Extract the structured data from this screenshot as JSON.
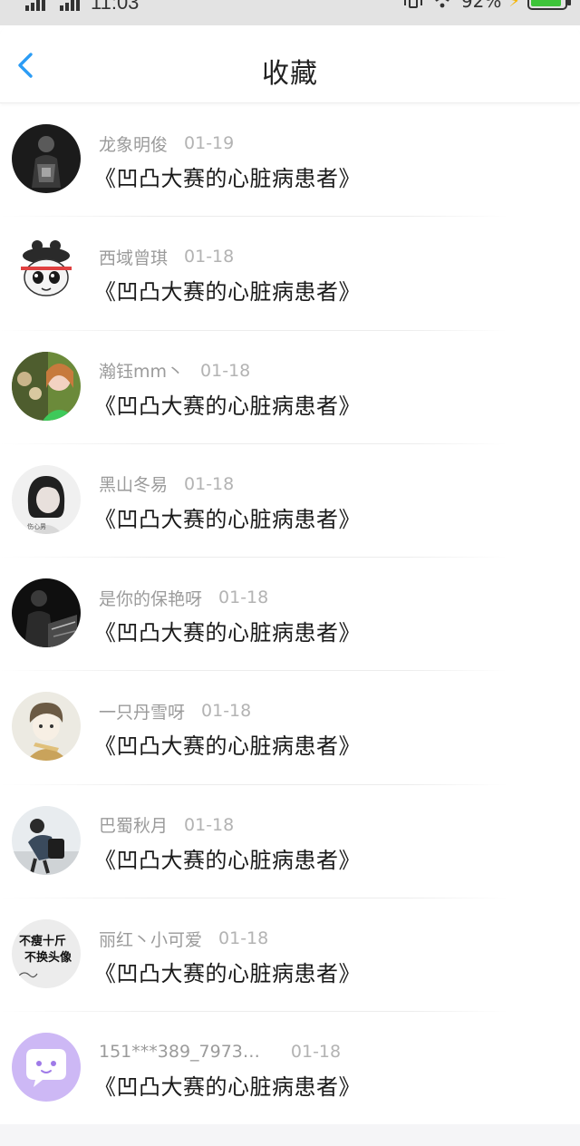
{
  "status_bar": {
    "time": "11:03",
    "battery": "92%",
    "battery_level": 0.92,
    "icons": [
      "signal-icon",
      "signal-icon",
      "vibrate-icon",
      "wifi-icon",
      "bolt-icon",
      "battery-icon"
    ]
  },
  "header": {
    "back_icon": "chevron-left-icon",
    "title": "收藏"
  },
  "colors": {
    "accent": "#2b9cf5",
    "text_primary": "#1a1a1a",
    "text_secondary": "#9b9b9b",
    "battery": "#3ec43a",
    "bolt": "#f5b300"
  },
  "items": [
    {
      "name": "龙象明俊",
      "date": "01-19",
      "title": "《凹凸大赛的心脏病患者》"
    },
    {
      "name": "西域曾琪",
      "date": "01-18",
      "title": "《凹凸大赛的心脏病患者》"
    },
    {
      "name": "瀚钰mm丶",
      "date": "01-18",
      "title": "《凹凸大赛的心脏病患者》"
    },
    {
      "name": "黑山冬易",
      "date": "01-18",
      "title": "《凹凸大赛的心脏病患者》"
    },
    {
      "name": "是你的保艳呀",
      "date": "01-18",
      "title": "《凹凸大赛的心脏病患者》"
    },
    {
      "name": "一只丹雪呀",
      "date": "01-18",
      "title": "《凹凸大赛的心脏病患者》"
    },
    {
      "name": "巴蜀秋月",
      "date": "01-18",
      "title": "《凹凸大赛的心脏病患者》"
    },
    {
      "name": "丽红丶小可爱",
      "date": "01-18",
      "title": "《凹凸大赛的心脏病患者》"
    },
    {
      "name": "151***389_7973…",
      "date": "01-18",
      "title": "《凹凸大赛的心脏病患者》"
    }
  ],
  "avatar_text": {
    "item8_line1": "不瘦十斤",
    "item8_line2": "不换头像",
    "item4_caption": "伤心男"
  }
}
